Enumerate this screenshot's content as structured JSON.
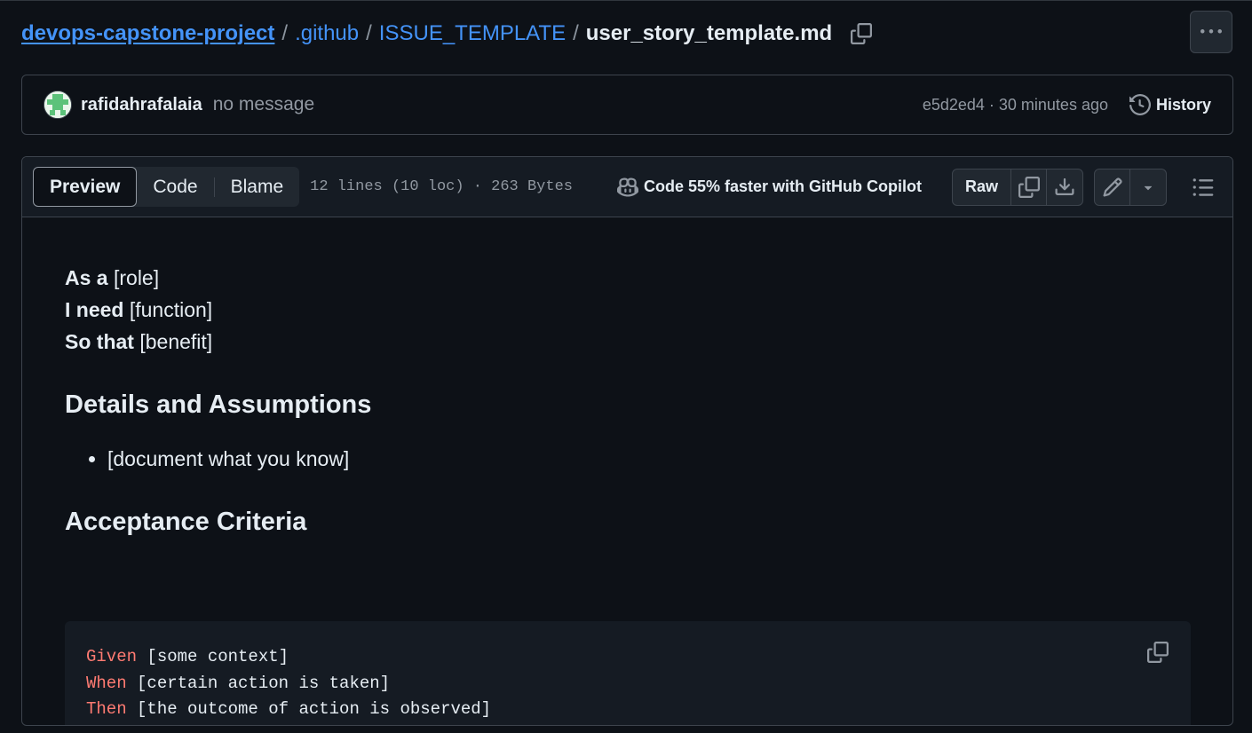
{
  "breadcrumb": {
    "repo": "devops-capstone-project",
    "sep": "/",
    "folder1": ".github",
    "folder2": "ISSUE_TEMPLATE",
    "file": "user_story_template.md"
  },
  "commit": {
    "author": "rafidahrafalaia",
    "message": "no message",
    "sha": "e5d2ed4",
    "dot": "·",
    "time": "30 minutes ago",
    "history_label": "History"
  },
  "file_header": {
    "tabs": [
      "Preview",
      "Code",
      "Blame"
    ],
    "active_tab": "Preview",
    "meta": "12 lines (10 loc) · 263 Bytes",
    "copilot_promo": "Code 55% faster with GitHub Copilot",
    "raw_label": "Raw"
  },
  "content": {
    "lines": [
      {
        "bold": "As a",
        "text": " [role]"
      },
      {
        "bold": "I need",
        "text": " [function]"
      },
      {
        "bold": "So that",
        "text": " [benefit]"
      }
    ],
    "heading_details": "Details and Assumptions",
    "details_items": [
      "[document what you know]"
    ],
    "heading_acceptance": "Acceptance Criteria",
    "code_lines": [
      {
        "keyword": "Given",
        "text": " [some context]"
      },
      {
        "keyword": "When",
        "text": " [certain action is taken]"
      },
      {
        "keyword": "Then",
        "text": " [the outcome of action is observed]"
      }
    ]
  },
  "colors": {
    "background": "#0d1117",
    "link": "#4493f8",
    "keyword": "#ff7b72",
    "muted": "#9198a1",
    "border": "#3d444d"
  }
}
